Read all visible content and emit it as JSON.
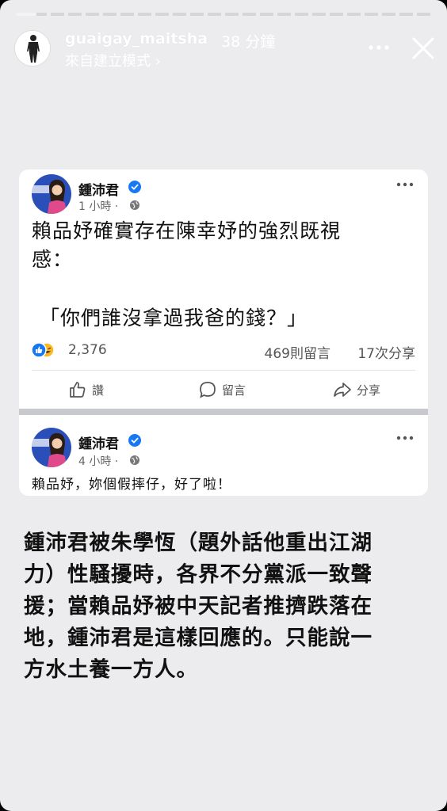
{
  "story": {
    "progress_fraction": 0.05,
    "username": "guaigay_maitsha",
    "time_ago": "38 分鐘",
    "subline": "來自建立模式 ›",
    "icons": {
      "more": "more-horizontal-icon",
      "close": "close-icon",
      "avatar": "profile-avatar"
    }
  },
  "post1": {
    "author": "鍾沛君",
    "time": "1 小時 ·",
    "body_lines": [
      "賴品妤確實存在陳幸妤的強烈既視",
      "感："
    ],
    "quote": "「你們誰沒拿過我爸的錢？」",
    "reaction_count": "2,376",
    "comment_count": "469則留言",
    "share_count": "17次分享",
    "actions": {
      "like": "讚",
      "comment": "留言",
      "share": "分享"
    }
  },
  "post2": {
    "author": "鍾沛君",
    "time": "4 小時 ·",
    "body": "賴品妤，妳個假摔仔，好了啦！"
  },
  "caption_lines": [
    "鍾沛君被朱學恆（題外話他重出江湖",
    "力）性騷擾時，各界不分黨派一致聲",
    "援；當賴品妤被中天記者推擠跌落在",
    "地，鍾沛君是這樣回應的。只能說一",
    "方水土養一方人。"
  ],
  "colors": {
    "background": "#ececee",
    "verified_blue": "#1877f2",
    "like_blue": "#1877f2",
    "haha_yellow": "#f7b928"
  }
}
